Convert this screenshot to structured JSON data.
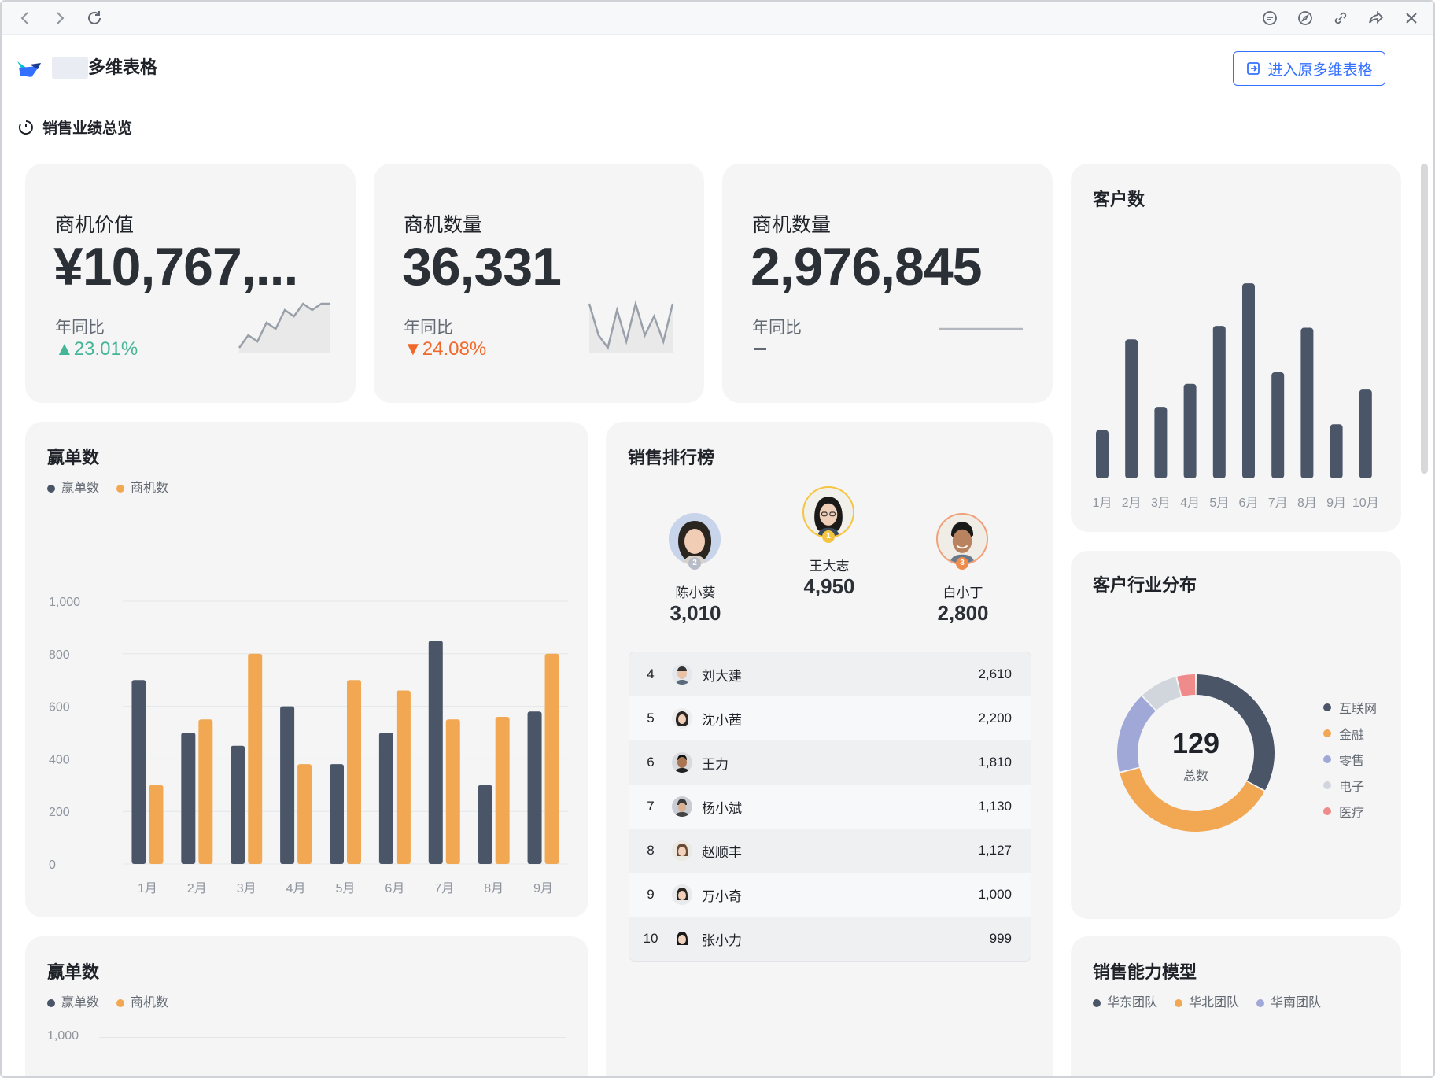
{
  "header": {
    "app_title": "多维表格",
    "enter_button": "进入原多维表格"
  },
  "section": {
    "title": "销售业绩总览"
  },
  "kpis": [
    {
      "label": "商机价值",
      "value": "¥10,767,...",
      "yoy_label": "年同比",
      "yoy_value": "23.01%",
      "trend": "up",
      "spark": [
        2,
        4,
        3,
        6,
        5,
        8,
        7,
        9,
        8,
        9,
        9
      ]
    },
    {
      "label": "商机数量",
      "value": "36,331",
      "yoy_label": "年同比",
      "yoy_value": "24.08%",
      "trend": "down",
      "spark": [
        8,
        3,
        1,
        7,
        2,
        8,
        3,
        6,
        2,
        8
      ]
    },
    {
      "label": "商机数量",
      "value": "2,976,845",
      "yoy_label": "年同比",
      "yoy_value": "",
      "trend": "flat",
      "spark": [
        5,
        5
      ]
    }
  ],
  "customers_card": {
    "title": "客户数",
    "chart_data": {
      "type": "bar",
      "categories": [
        "1月",
        "2月",
        "3月",
        "4月",
        "5月",
        "6月",
        "7月",
        "8月",
        "9月",
        "10月"
      ],
      "values": [
        25,
        72,
        37,
        49,
        79,
        101,
        55,
        78,
        28,
        46
      ],
      "ylim": [
        0,
        110
      ],
      "color": "#4a5567"
    }
  },
  "wins_card": {
    "title": "赢单数",
    "legend": [
      "赢单数",
      "商机数"
    ],
    "colors": [
      "#4a5567",
      "#f2a852"
    ],
    "chart_data": {
      "type": "bar",
      "categories": [
        "1月",
        "2月",
        "3月",
        "4月",
        "5月",
        "6月",
        "7月",
        "8月",
        "9月"
      ],
      "series": [
        {
          "name": "赢单数",
          "values": [
            700,
            500,
            450,
            600,
            380,
            500,
            850,
            300,
            580
          ]
        },
        {
          "name": "商机数",
          "values": [
            300,
            550,
            800,
            380,
            700,
            660,
            550,
            560,
            800
          ]
        }
      ],
      "yticks": [
        "0",
        "200",
        "400",
        "600",
        "800",
        "1,000"
      ],
      "ylim": [
        0,
        1000
      ],
      "grid": true
    }
  },
  "wins_card2": {
    "title": "赢单数",
    "legend": [
      "赢单数",
      "商机数"
    ],
    "ytick_top": "1,000"
  },
  "ranking": {
    "title": "销售排行榜",
    "podium": [
      {
        "rank": "1",
        "name": "王大志",
        "value": "4,950"
      },
      {
        "rank": "2",
        "name": "陈小葵",
        "value": "3,010"
      },
      {
        "rank": "3",
        "name": "白小丁",
        "value": "2,800"
      }
    ],
    "rows": [
      {
        "rank": "4",
        "name": "刘大建",
        "value": "2,610"
      },
      {
        "rank": "5",
        "name": "沈小茜",
        "value": "2,200"
      },
      {
        "rank": "6",
        "name": "王力",
        "value": "1,810"
      },
      {
        "rank": "7",
        "name": "杨小斌",
        "value": "1,130"
      },
      {
        "rank": "8",
        "name": "赵顺丰",
        "value": "1,127"
      },
      {
        "rank": "9",
        "name": "万小奇",
        "value": "1,000"
      },
      {
        "rank": "10",
        "name": "张小力",
        "value": "999"
      }
    ]
  },
  "industry_card": {
    "title": "客户行业分布",
    "center_value": "129",
    "center_label": "总数",
    "chart_data": {
      "type": "pie",
      "categories": [
        "互联网",
        "金融",
        "零售",
        "电子",
        "医疗"
      ],
      "values": [
        33,
        38,
        17,
        8,
        4
      ],
      "colors": [
        "#4a5567",
        "#f2a852",
        "#a0a8d8",
        "#d1d5dc",
        "#f08b8b"
      ]
    }
  },
  "ability_card": {
    "title": "销售能力模型",
    "legend": [
      "华东团队",
      "华北团队",
      "华南团队"
    ],
    "colors": [
      "#4a5567",
      "#f2a852",
      "#a0a8d8"
    ]
  }
}
